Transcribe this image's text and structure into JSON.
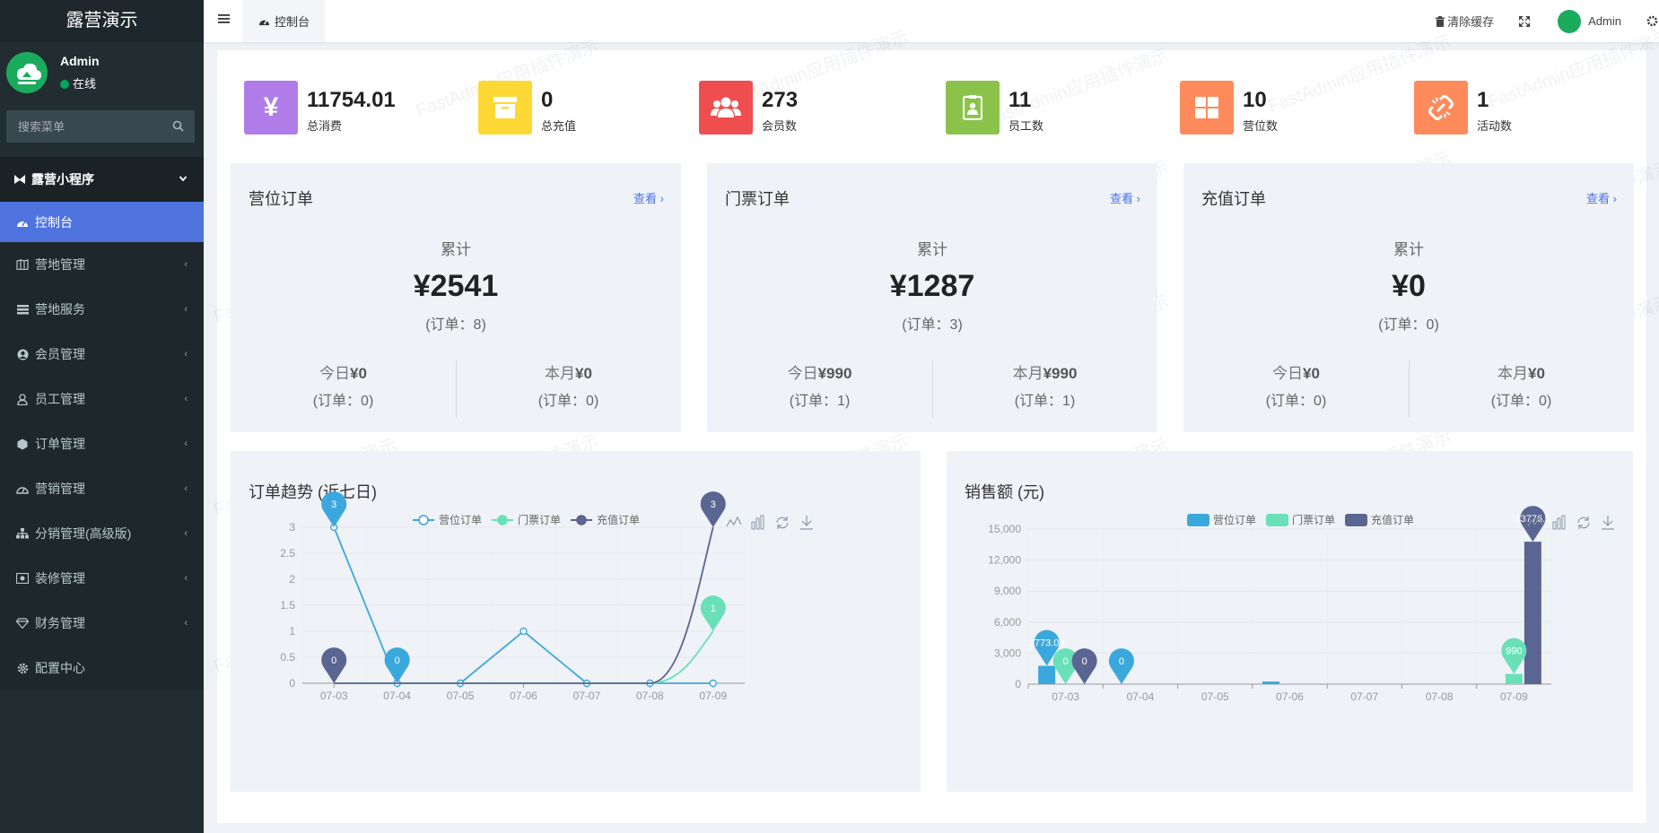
{
  "sidebar": {
    "brand": "露营演示",
    "user": {
      "name": "Admin",
      "status": "在线"
    },
    "search_placeholder": "搜索菜单",
    "section": "露营小程序",
    "items": [
      {
        "label": "控制台",
        "icon": "dashboard-icon",
        "active": true
      },
      {
        "label": "营地管理",
        "icon": "map-icon"
      },
      {
        "label": "营地服务",
        "icon": "list-icon"
      },
      {
        "label": "会员管理",
        "icon": "user-circle-icon"
      },
      {
        "label": "员工管理",
        "icon": "user-icon"
      },
      {
        "label": "订单管理",
        "icon": "cube-icon"
      },
      {
        "label": "营销管理",
        "icon": "tachometer-icon"
      },
      {
        "label": "分销管理(高级版)",
        "icon": "sitemap-icon"
      },
      {
        "label": "装修管理",
        "icon": "picture-icon"
      },
      {
        "label": "财务管理",
        "icon": "diamond-icon"
      },
      {
        "label": "配置中心",
        "icon": "gear-icon"
      }
    ]
  },
  "topnav": {
    "tab": "控制台",
    "clear_cache": "清除缓存",
    "user": "Admin"
  },
  "stats": [
    {
      "value": "11754.01",
      "label": "总消费",
      "color": "#b07de8",
      "icon": "yen-icon"
    },
    {
      "value": "0",
      "label": "总充值",
      "color": "#fdd835",
      "icon": "archive-icon"
    },
    {
      "value": "273",
      "label": "会员数",
      "color": "#ef4e4e",
      "icon": "users-icon"
    },
    {
      "value": "11",
      "label": "员工数",
      "color": "#8bc34a",
      "icon": "badge-icon"
    },
    {
      "value": "10",
      "label": "营位数",
      "color": "#ff8a5b",
      "icon": "grid-icon"
    },
    {
      "value": "1",
      "label": "活动数",
      "color": "#ff8a5b",
      "icon": "unlink-icon"
    }
  ],
  "order_cards": [
    {
      "title": "营位订单",
      "more": "查看",
      "total_label": "累计",
      "total": "¥2541",
      "total_count": "(订单：8)",
      "today_label": "今日",
      "today": "¥0",
      "today_count": "(订单：0)",
      "month_label": "本月",
      "month": "¥0",
      "month_count": "(订单：0)"
    },
    {
      "title": "门票订单",
      "more": "查看",
      "total_label": "累计",
      "total": "¥1287",
      "total_count": "(订单：3)",
      "today_label": "今日",
      "today": "¥990",
      "today_count": "(订单：1)",
      "month_label": "本月",
      "month": "¥990",
      "month_count": "(订单：1)"
    },
    {
      "title": "充值订单",
      "more": "查看",
      "total_label": "累计",
      "total": "¥0",
      "total_count": "(订单：0)",
      "today_label": "今日",
      "today": "¥0",
      "today_count": "(订单：0)",
      "month_label": "本月",
      "month": "¥0",
      "month_count": "(订单：0)"
    }
  ],
  "charts": {
    "trend_title": "订单趋势 (近七日)",
    "sales_title": "销售额 (元)"
  },
  "watermark": "FastAdmin应用插件演示",
  "colors": {
    "营位订单": "#3ba8dd",
    "门票订单": "#6ae0b8",
    "充值订单": "#5b6591"
  },
  "chart_data": [
    {
      "type": "line",
      "categories": [
        "07-03",
        "07-04",
        "07-05",
        "07-06",
        "07-07",
        "07-08",
        "07-09"
      ],
      "series": [
        {
          "name": "营位订单",
          "values": [
            3,
            0,
            0,
            1,
            0,
            0,
            0
          ]
        },
        {
          "name": "门票订单",
          "values": [
            0,
            0,
            0,
            0,
            0,
            0,
            1
          ]
        },
        {
          "name": "充值订单",
          "values": [
            0,
            0,
            0,
            0,
            0,
            0,
            3
          ]
        }
      ],
      "ylim": [
        0,
        3
      ],
      "yticks": [
        "0",
        "0.5",
        "1",
        "1.5",
        "2",
        "2.5",
        "3"
      ],
      "markers": [
        {
          "series": "营位订单",
          "index": 0,
          "label": "3"
        },
        {
          "series": "营位订单",
          "index": 1,
          "label": "0"
        },
        {
          "series": "充值订单",
          "index": 0,
          "label": "0"
        },
        {
          "series": "充值订单",
          "index": 6,
          "label": "3"
        },
        {
          "series": "门票订单",
          "index": 6,
          "label": "1"
        }
      ],
      "legend": "top-center",
      "grid": true
    },
    {
      "type": "bar",
      "categories": [
        "07-03",
        "07-04",
        "07-05",
        "07-06",
        "07-07",
        "07-08",
        "07-09"
      ],
      "series": [
        {
          "name": "营位订单",
          "values": [
            1773.03,
            0,
            0,
            254,
            0,
            0,
            0
          ]
        },
        {
          "name": "门票订单",
          "values": [
            0,
            0,
            0,
            0,
            0,
            0,
            990
          ]
        },
        {
          "name": "充值订单",
          "values": [
            0,
            0,
            0,
            0,
            0,
            0,
            13776.1
          ]
        }
      ],
      "ylim": [
        0,
        15000
      ],
      "yticks": [
        "0",
        "3,000",
        "6,000",
        "9,000",
        "12,000",
        "15,000"
      ],
      "markers": [
        {
          "series": "营位订单",
          "index": 0,
          "label": "1773.03"
        },
        {
          "series": "门票订单",
          "index": 0,
          "label": "0"
        },
        {
          "series": "充值订单",
          "index": 0,
          "label": "0"
        },
        {
          "series": "营位订单",
          "index": 1,
          "label": "0"
        },
        {
          "series": "门票订单",
          "index": 6,
          "label": "990"
        },
        {
          "series": "充值订单",
          "index": 6,
          "label": "13776.1"
        }
      ],
      "legend": "top-center",
      "grid": true
    }
  ]
}
